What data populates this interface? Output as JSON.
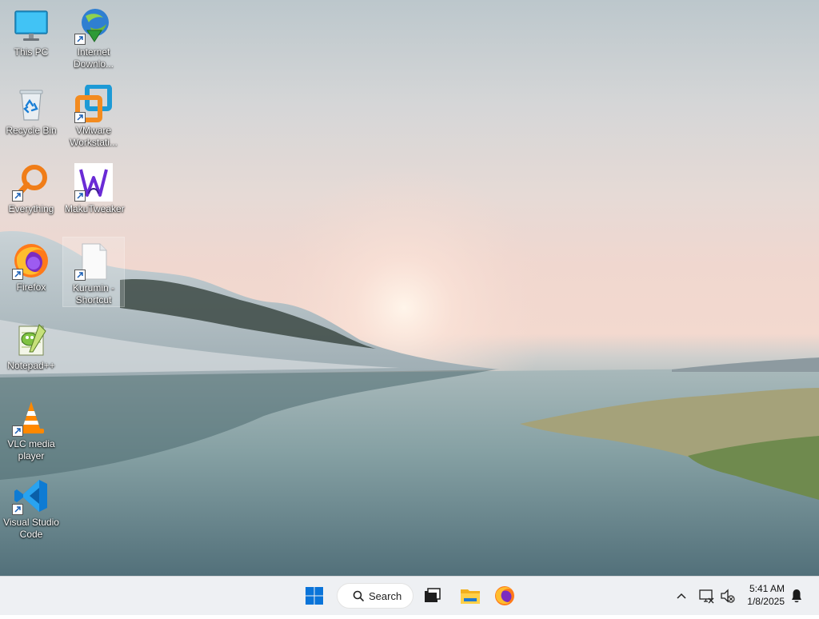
{
  "desktop_icons": [
    {
      "label": "This PC",
      "icon": "monitor-icon"
    },
    {
      "label": "Internet Downlo...",
      "icon": "internet-download-manager-icon"
    },
    {
      "label": "Recycle Bin",
      "icon": "recycle-bin-icon"
    },
    {
      "label": "VMware Workstati...",
      "icon": "vmware-icon"
    },
    {
      "label": "Everything",
      "icon": "magnifier-icon"
    },
    {
      "label": "MakuTweaker",
      "icon": "makutweaker-icon"
    },
    {
      "label": "Firefox",
      "icon": "firefox-icon"
    },
    {
      "label": "Kurumin - Shortcut",
      "icon": "blank-file-icon"
    },
    {
      "label": "Notepad++",
      "icon": "notepadpp-icon"
    },
    {
      "label": "VLC media player",
      "icon": "vlc-cone-icon"
    },
    {
      "label": "Visual Studio Code",
      "icon": "vscode-icon"
    }
  ],
  "taskbar": {
    "search_label": "Search",
    "pinned": [
      {
        "name": "start-button",
        "icon": "windows-logo-icon"
      },
      {
        "name": "task-view-button",
        "icon": "task-view-icon"
      },
      {
        "name": "file-explorer-button",
        "icon": "folder-icon"
      },
      {
        "name": "firefox-taskbar-button",
        "icon": "firefox-icon"
      }
    ],
    "clock": {
      "time": "5:41 AM",
      "date": "1/8/2025"
    }
  },
  "colors": {
    "taskbar_bg": "#eef0f3",
    "accent": "#0078d4"
  }
}
